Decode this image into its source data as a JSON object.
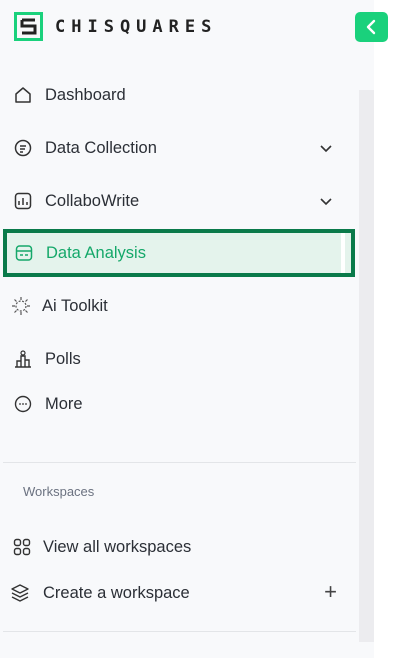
{
  "brand": {
    "name": "CHISQUARES",
    "accent": "#1ad17c",
    "active_border": "#0a7a4a",
    "active_text": "#15a86a"
  },
  "nav": {
    "items": [
      {
        "label": "Dashboard",
        "icon": "home-icon"
      },
      {
        "label": "Data Collection",
        "icon": "data-collection-icon",
        "has_chevron": true
      },
      {
        "label": "CollaboWrite",
        "icon": "collabowrite-icon",
        "has_chevron": true
      },
      {
        "label": "Data Analysis",
        "icon": "data-analysis-icon",
        "active": true
      },
      {
        "label": "Ai Toolkit",
        "icon": "ai-toolkit-icon"
      },
      {
        "label": "Polls",
        "icon": "polls-icon"
      },
      {
        "label": "More",
        "icon": "more-icon"
      }
    ]
  },
  "workspaces": {
    "title": "Workspaces",
    "items": [
      {
        "label": "View all workspaces",
        "icon": "grid-icon"
      },
      {
        "label": "Create a workspace",
        "icon": "layers-icon",
        "action": "+"
      }
    ]
  }
}
